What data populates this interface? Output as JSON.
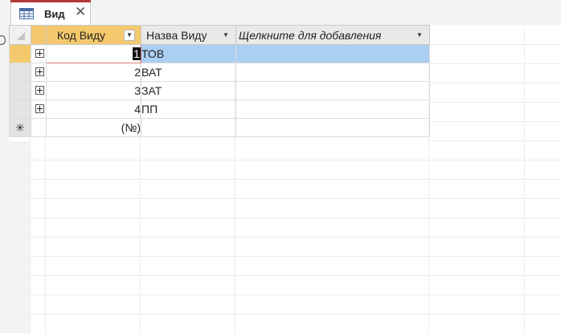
{
  "tab": {
    "title": "Вид",
    "close_glyph": "✕",
    "icon": "datasheet-table-icon"
  },
  "columns": {
    "id_header": "Код Виду",
    "name_header": "Назва Виду",
    "add_header": "Щелкните для добавления",
    "dropdown_glyph": "▼"
  },
  "rows": [
    {
      "id": "1",
      "name": "ТОВ"
    },
    {
      "id": "2",
      "name": "ВАТ"
    },
    {
      "id": "3",
      "name": "ЗАТ"
    },
    {
      "id": "4",
      "name": "ПП"
    }
  ],
  "new_record": {
    "marker": "✳",
    "placeholder": "(№)"
  },
  "colors": {
    "selected_header": "#f4c96e",
    "selected_row": "#aacff2",
    "tab_accent": "#b23a3a"
  }
}
